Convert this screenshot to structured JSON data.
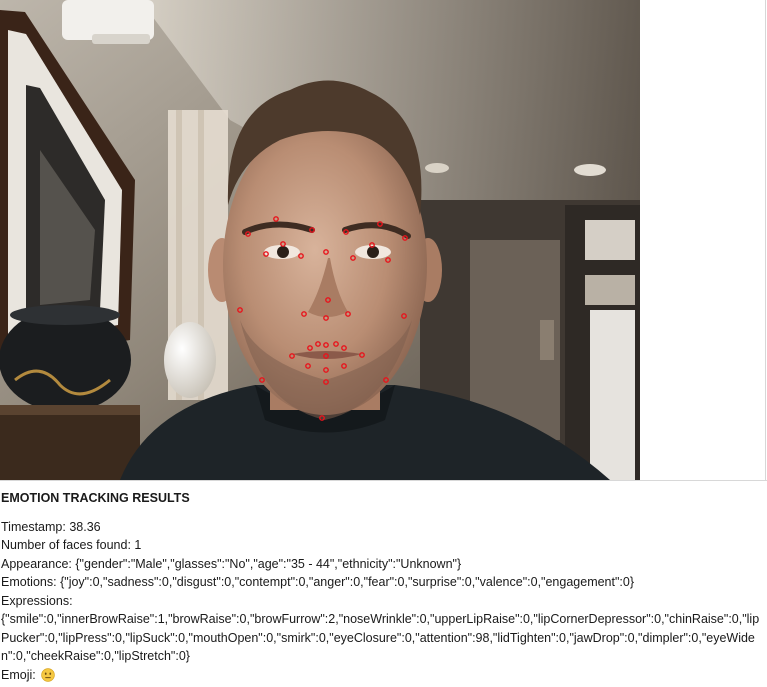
{
  "results": {
    "heading": "EMOTION TRACKING RESULTS",
    "timestamp_label": "Timestamp:",
    "timestamp_value": "38.36",
    "faces_label": "Number of faces found:",
    "faces_value": "1",
    "appearance_label": "Appearance:",
    "appearance_value": "{\"gender\":\"Male\",\"glasses\":\"No\",\"age\":\"35 - 44\",\"ethnicity\":\"Unknown\"}",
    "emotions_label": "Emotions:",
    "emotions_value": "{\"joy\":0,\"sadness\":0,\"disgust\":0,\"contempt\":0,\"anger\":0,\"fear\":0,\"surprise\":0,\"valence\":0,\"engagement\":0}",
    "expressions_label": "Expressions:",
    "expressions_value": "{\"smile\":0,\"innerBrowRaise\":1,\"browRaise\":0,\"browFurrow\":2,\"noseWrinkle\":0,\"upperLipRaise\":0,\"lipCornerDepressor\":0,\"chinRaise\":0,\"lipPucker\":0,\"lipPress\":0,\"lipSuck\":0,\"mouthOpen\":0,\"smirk\":0,\"eyeClosure\":0,\"attention\":98,\"lidTighten\":0,\"jawDrop\":0,\"dimpler\":0,\"eyeWiden\":0,\"cheekRaise\":0,\"lipStretch\":0}",
    "emoji_label": "Emoji:",
    "emoji_icon": "neutral-face-icon"
  },
  "colors": {
    "landmark": "#e8141c",
    "emoji_face": "#f5c842"
  }
}
